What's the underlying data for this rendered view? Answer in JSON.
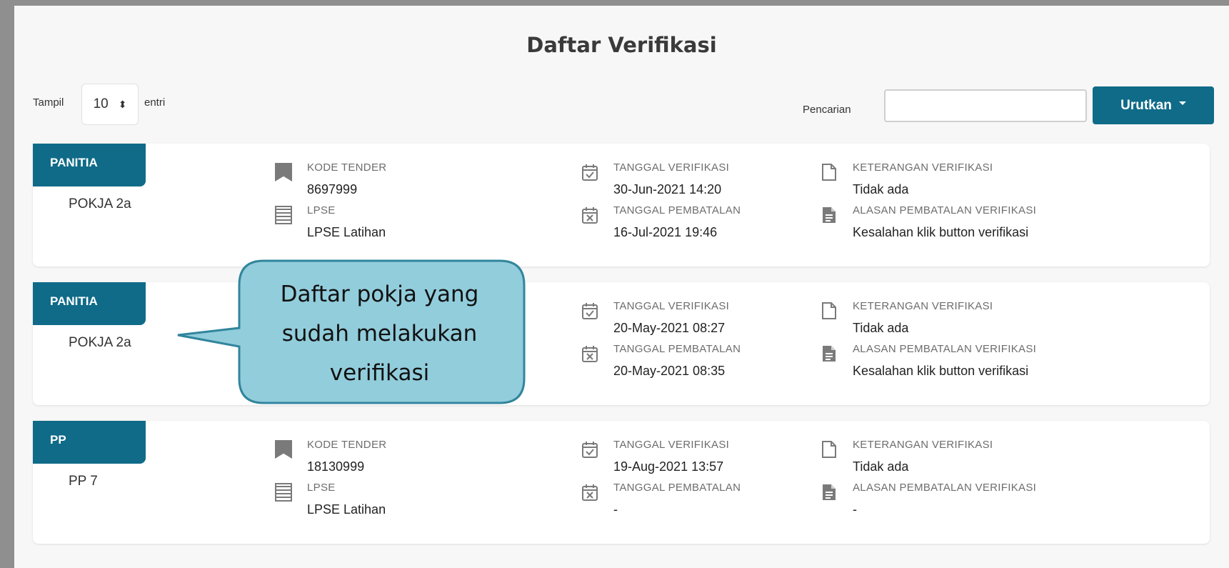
{
  "header": {
    "title": "Daftar Verifikasi"
  },
  "controls": {
    "show_label": "Tampil",
    "entries_value": "10",
    "entries_suffix": "entri",
    "search_label": "Pencarian",
    "search_value": "",
    "sort_label": "Urutkan"
  },
  "cards": [
    {
      "tag": "PANITIA",
      "group": "POKJA 2a",
      "kode_label": "KODE TENDER",
      "kode_value": "8697999",
      "lpse_label": "LPSE",
      "lpse_value": "LPSE Latihan",
      "tgl_verif_label": "TANGGAL VERIFIKASI",
      "tgl_verif_value": "30-Jun-2021 14:20",
      "tgl_batal_label": "TANGGAL PEMBATALAN",
      "tgl_batal_value": "16-Jul-2021 19:46",
      "ket_label": "KETERANGAN VERIFIKASI",
      "ket_value": "Tidak ada",
      "alasan_label": "ALASAN PEMBATALAN VERIFIKASI",
      "alasan_value": "Kesalahan klik button verifikasi"
    },
    {
      "tag": "PANITIA",
      "group": "POKJA 2a",
      "tgl_verif_label": "TANGGAL VERIFIKASI",
      "tgl_verif_value": "20-May-2021 08:27",
      "tgl_batal_label": "TANGGAL PEMBATALAN",
      "tgl_batal_value": "20-May-2021 08:35",
      "ket_label": "KETERANGAN VERIFIKASI",
      "ket_value": "Tidak ada",
      "alasan_label": "ALASAN PEMBATALAN VERIFIKASI",
      "alasan_value": "Kesalahan klik button verifikasi"
    },
    {
      "tag": "PP",
      "group": "PP 7",
      "kode_label": "KODE TENDER",
      "kode_value": "18130999",
      "lpse_label": "LPSE",
      "lpse_value": "LPSE Latihan",
      "tgl_verif_label": "TANGGAL VERIFIKASI",
      "tgl_verif_value": "19-Aug-2021 13:57",
      "tgl_batal_label": "TANGGAL PEMBATALAN",
      "tgl_batal_value": "-",
      "ket_label": "KETERANGAN VERIFIKASI",
      "ket_value": "Tidak ada",
      "alasan_label": "ALASAN PEMBATALAN VERIFIKASI",
      "alasan_value": "-"
    }
  ],
  "callout": {
    "text": "Daftar pokja yang sudah melakukan verifikasi"
  },
  "colors": {
    "accent": "#0f6b88",
    "callout_fill": "#92cddc",
    "callout_border": "#31859c"
  }
}
